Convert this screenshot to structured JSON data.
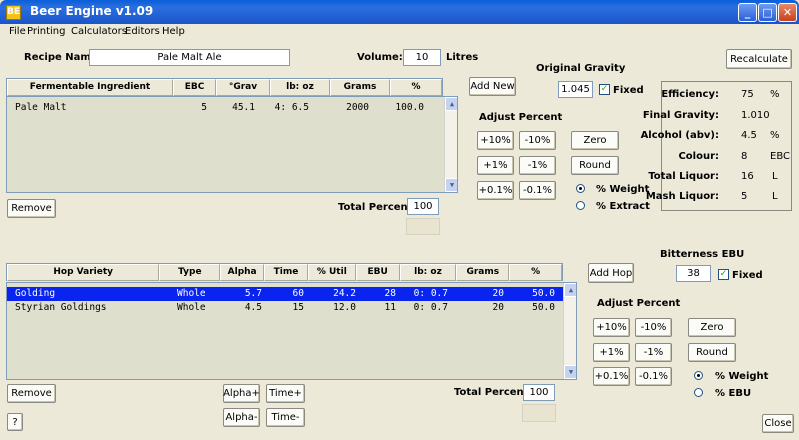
{
  "window": {
    "title": "Beer Engine v1.09",
    "icon_text": "BE"
  },
  "menu": [
    "File",
    "Printing",
    "Calculators",
    "Editors",
    "Help"
  ],
  "recipe": {
    "name_label": "Recipe Name:",
    "name": "Pale Malt Ale",
    "volume_label": "Volume:",
    "volume": "10",
    "volume_unit": "Litres",
    "recalc": "Recalculate"
  },
  "og": {
    "label": "Original Gravity",
    "value": "1.045",
    "fixed": "Fixed"
  },
  "ferm": {
    "headers": [
      "Fermentable Ingredient",
      "EBC",
      "°Grav",
      "lb: oz",
      "Grams",
      "%"
    ],
    "rows": [
      [
        "Pale Malt",
        "5",
        "45.1",
        "4: 6.5",
        "2000",
        "100.0"
      ]
    ],
    "add_new": "Add New",
    "remove": "Remove",
    "total_label": "Total Percent:",
    "total": "100",
    "adjust_label": "Adjust Percent",
    "adj": [
      "+10%",
      "-10%",
      "+1%",
      "-1%",
      "+0.1%",
      "-0.1%"
    ],
    "zero": "Zero",
    "round": "Round",
    "weight": "% Weight",
    "extract": "% Extract"
  },
  "stats": [
    {
      "label": "Efficiency:",
      "value": "75",
      "unit": "%"
    },
    {
      "label": "Final Gravity:",
      "value": "1.010",
      "unit": ""
    },
    {
      "label": "Alcohol (abv):",
      "value": "4.5",
      "unit": "%"
    },
    {
      "label": "Colour:",
      "value": "8",
      "unit": "EBC"
    },
    {
      "label": "Total Liquor:",
      "value": "16",
      "unit": "L"
    },
    {
      "label": "Mash Liquor:",
      "value": "5",
      "unit": "L"
    }
  ],
  "hops": {
    "headers": [
      "Hop Variety",
      "Type",
      "Alpha",
      "Time",
      "% Util",
      "EBU",
      "lb: oz",
      "Grams",
      "%"
    ],
    "rows": [
      [
        "Golding",
        "Whole",
        "5.7",
        "60",
        "24.2",
        "28",
        "0: 0.7",
        "20",
        "50.0"
      ],
      [
        "Styrian Goldings",
        "Whole",
        "4.5",
        "15",
        "12.0",
        "11",
        "0: 0.7",
        "20",
        "50.0"
      ]
    ],
    "add_hop": "Add Hop",
    "remove": "Remove",
    "alpha_plus": "Alpha+",
    "alpha_minus": "Alpha-",
    "time_plus": "Time+",
    "time_minus": "Time-",
    "total_label": "Total Percent:",
    "total": "100",
    "adjust_label": "Adjust Percent",
    "adj": [
      "+10%",
      "-10%",
      "+1%",
      "-1%",
      "+0.1%",
      "-0.1%"
    ],
    "zero": "Zero",
    "round": "Round",
    "weight": "% Weight",
    "ebu": "% EBU"
  },
  "bitterness": {
    "label": "Bitterness EBU",
    "value": "38",
    "fixed": "Fixed"
  },
  "help": "?",
  "close": "Close"
}
